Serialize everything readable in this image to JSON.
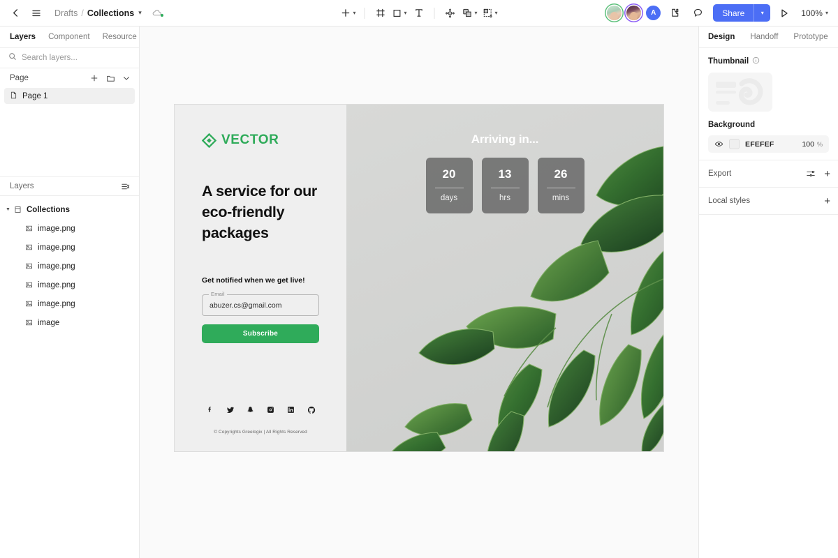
{
  "topbar": {
    "back_icon": "chevron-left-icon",
    "menu_icon": "hamburger-menu-icon",
    "breadcrumb": {
      "root": "Drafts",
      "separator": "/",
      "current": "Collections",
      "chevron": "⌄"
    },
    "cloud_icon": "cloud-saved-icon",
    "tools": [
      {
        "name": "add-tool",
        "icon": "plus-icon",
        "has_chevron": true
      },
      {
        "name": "frame-tool",
        "icon": "frame-icon",
        "has_chevron": false
      },
      {
        "name": "shape-tool",
        "icon": "square-icon",
        "has_chevron": true
      },
      {
        "name": "text-tool",
        "icon": "text-icon",
        "has_chevron": false
      },
      {
        "name": "move-tool",
        "icon": "move-icon",
        "has_chevron": false
      },
      {
        "name": "component-tool",
        "icon": "duplicate-icon",
        "has_chevron": true
      },
      {
        "name": "mask-tool",
        "icon": "mask-icon",
        "has_chevron": true
      }
    ],
    "avatars": [
      {
        "name": "collaborator-avatar-1",
        "type": "photo",
        "ring": "#5bc07a"
      },
      {
        "name": "collaborator-avatar-2",
        "type": "photo",
        "ring": "#8b5cf6"
      },
      {
        "name": "current-user-avatar",
        "type": "letter",
        "letter": "A",
        "color": "#4c6ef5"
      }
    ],
    "plugin_icon": "plugin-icon",
    "comment_icon": "comment-bubble-icon",
    "share_label": "Share",
    "share_color": "#4c6ef5",
    "present_icon": "play-present-icon",
    "zoom_level": "100%"
  },
  "left_panel": {
    "tabs": [
      {
        "label": "Layers",
        "active": true
      },
      {
        "label": "Component",
        "active": false
      },
      {
        "label": "Resource",
        "active": false
      }
    ],
    "search_placeholder": "Search layers...",
    "search_value": "",
    "page_section": {
      "title": "Page",
      "add_icon": "plus-icon",
      "folder_icon": "folder-icon",
      "collapse_icon": "chevron-down-icon",
      "pages": [
        {
          "label": "Page 1",
          "icon": "page-icon",
          "selected": true
        }
      ]
    },
    "layers_section": {
      "title": "Layers",
      "collapse_all_icon": "collapse-layers-icon",
      "items": [
        {
          "label": "Collections",
          "icon": "frame-icon",
          "depth": 0,
          "expanded": true
        },
        {
          "label": "image.png",
          "icon": "image-icon",
          "depth": 1
        },
        {
          "label": "image.png",
          "icon": "image-icon",
          "depth": 1
        },
        {
          "label": "image.png",
          "icon": "image-icon",
          "depth": 1
        },
        {
          "label": "image.png",
          "icon": "image-icon",
          "depth": 1
        },
        {
          "label": "image.png",
          "icon": "image-icon",
          "depth": 1
        },
        {
          "label": "image",
          "icon": "image-icon",
          "depth": 1
        }
      ]
    }
  },
  "design": {
    "logo_text": "VECTOR",
    "logo_color": "#2fab5a",
    "heading": "A service for our eco-friendly packages",
    "subheading": "Get notified when we get live!",
    "email_field": {
      "label": "Email",
      "value": "abuzer.cs@gmail.com",
      "placeholder": "Email"
    },
    "subscribe_label": "Subscribe",
    "subscribe_color": "#2fab5a",
    "socials": [
      {
        "name": "facebook-icon"
      },
      {
        "name": "twitter-icon"
      },
      {
        "name": "snapchat-icon"
      },
      {
        "name": "instagram-icon"
      },
      {
        "name": "linkedin-icon"
      },
      {
        "name": "github-icon"
      }
    ],
    "copyright": "© Copyrights Greelogix | All Rights Reserved",
    "countdown": {
      "title": "Arriving in...",
      "units": [
        {
          "value": "20",
          "unit": "days"
        },
        {
          "value": "13",
          "unit": "hrs"
        },
        {
          "value": "26",
          "unit": "mins"
        }
      ]
    }
  },
  "right_panel": {
    "tabs": [
      {
        "label": "Design",
        "active": true
      },
      {
        "label": "Handoff",
        "active": false
      },
      {
        "label": "Prototype",
        "active": false
      }
    ],
    "thumbnail": {
      "title": "Thumbnail",
      "info_icon": "info-icon"
    },
    "background": {
      "title": "Background",
      "visibility_icon": "eye-icon",
      "hex": "EFEFEF",
      "opacity": "100",
      "opacity_unit": "%"
    },
    "export": {
      "title": "Export",
      "settings_icon": "sliders-icon",
      "add_icon": "plus-icon"
    },
    "local_styles": {
      "title": "Local styles",
      "add_icon": "plus-icon"
    }
  }
}
